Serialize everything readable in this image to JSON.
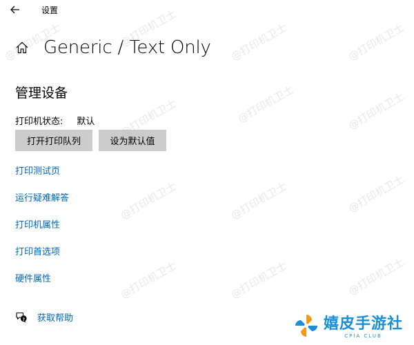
{
  "titlebar": {
    "back_icon": "back-arrow-icon",
    "title": "设置"
  },
  "header": {
    "home_icon": "home-icon",
    "title": "Generic / Text Only"
  },
  "manage": {
    "heading": "管理设备",
    "status_label": "打印机状态:",
    "status_value": "默认",
    "buttons": {
      "open_queue": "打开打印队列",
      "set_default": "设为默认值"
    },
    "links": [
      "打印测试页",
      "运行疑难解答",
      "打印机属性",
      "打印首选项",
      "硬件属性"
    ]
  },
  "help": {
    "icon": "help-chat-icon",
    "label": "获取帮助"
  },
  "watermark": {
    "text": "@打印机卫士"
  },
  "logo": {
    "name": "嬉皮手游社",
    "sub": "CPIA CLUB"
  },
  "colors": {
    "link": "#0067b8",
    "button_bg": "#cccccc",
    "logo_blue": "#1a8fd6",
    "logo_orange": "#f39a1e"
  }
}
